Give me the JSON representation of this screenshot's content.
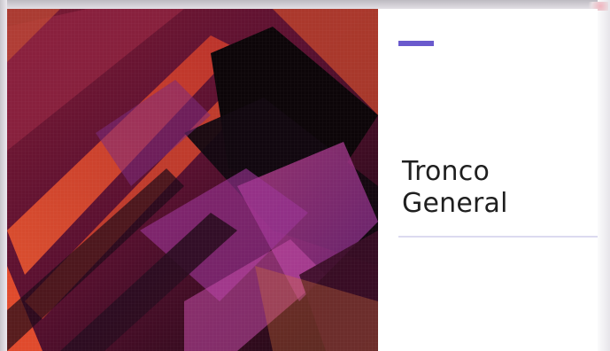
{
  "slide": {
    "title_line1": "Tronco",
    "title_line2": "General",
    "accent_color": "#6a5acd",
    "divider_color": "#dcdaf0",
    "artwork": "abstract-geometric-magenta-purple-orange"
  }
}
